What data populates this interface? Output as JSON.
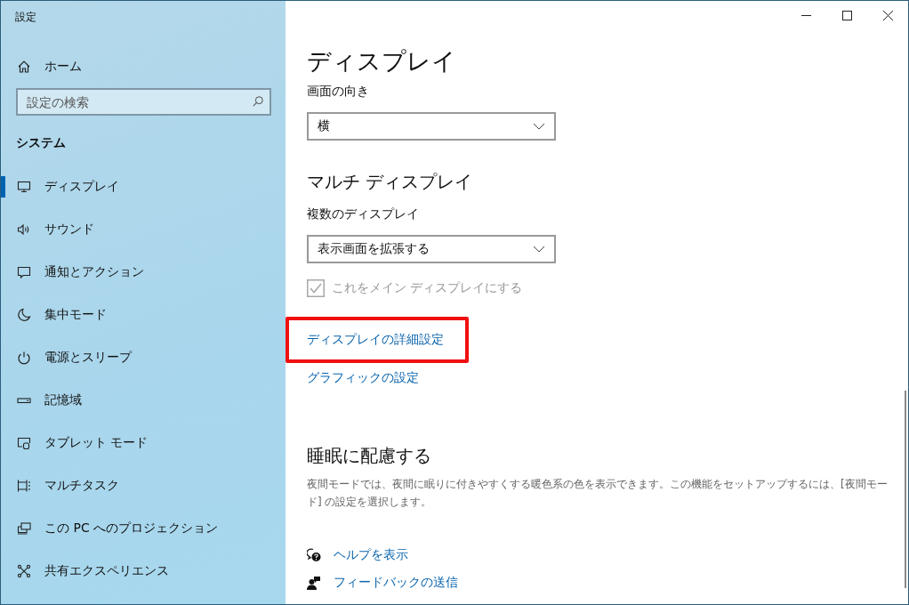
{
  "window": {
    "title": "設定"
  },
  "sidebar": {
    "home": "ホーム",
    "search": {
      "placeholder": "設定の検索"
    },
    "section": "システム",
    "items": [
      {
        "label": "ディスプレイ",
        "selected": true
      },
      {
        "label": "サウンド",
        "selected": false
      },
      {
        "label": "通知とアクション",
        "selected": false
      },
      {
        "label": "集中モード",
        "selected": false
      },
      {
        "label": "電源とスリープ",
        "selected": false
      },
      {
        "label": "記憶域",
        "selected": false
      },
      {
        "label": "タブレット モード",
        "selected": false
      },
      {
        "label": "マルチタスク",
        "selected": false
      },
      {
        "label": "この PC へのプロジェクション",
        "selected": false
      },
      {
        "label": "共有エクスペリエンス",
        "selected": false
      }
    ]
  },
  "content": {
    "heading": "ディスプレイ",
    "orientation": {
      "label": "画面の向き",
      "value": "横"
    },
    "multi_heading": "マルチ ディスプレイ",
    "multi": {
      "label": "複数のディスプレイ",
      "value": "表示画面を拡張する"
    },
    "main_display": {
      "label": "これをメイン ディスプレイにする",
      "checked": true,
      "disabled": true
    },
    "links": [
      {
        "label": "ディスプレイの詳細設定",
        "highlighted": true
      },
      {
        "label": "グラフィックの設定",
        "highlighted": false
      }
    ],
    "sleep": {
      "heading": "睡眠に配慮する",
      "text": "夜間モードでは、夜間に眠りに付きやすくする暖色系の色を表示できます。この機能をセットアップするには、[夜間モード] の設定を選択します。"
    },
    "help": [
      {
        "kind": "help",
        "label": "ヘルプを表示"
      },
      {
        "kind": "feedback",
        "label": "フィードバックの送信"
      }
    ]
  }
}
